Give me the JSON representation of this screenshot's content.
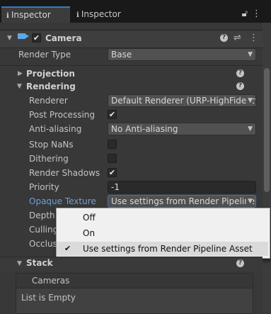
{
  "tabs": [
    {
      "label": "Inspector",
      "icon": "info-icon",
      "active": true
    },
    {
      "label": "Inspector",
      "icon": "info-icon",
      "active": false
    }
  ],
  "tab_icons": {
    "lock": "lock-icon",
    "menu": "kebab-menu-icon"
  },
  "component": {
    "title": "Camera",
    "enabled": true,
    "render_type_label": "Render Type",
    "render_type_value": "Base"
  },
  "sections": {
    "projection": "Projection",
    "rendering": "Rendering",
    "stack": "Stack"
  },
  "rendering": {
    "renderer_label": "Renderer",
    "renderer_value": "Default Renderer (URP-HighFidelity)",
    "post_processing_label": "Post Processing",
    "post_processing_checked": true,
    "anti_aliasing_label": "Anti-aliasing",
    "anti_aliasing_value": "No Anti-aliasing",
    "stop_nans_label": "Stop NaNs",
    "stop_nans_checked": false,
    "dithering_label": "Dithering",
    "dithering_checked": false,
    "render_shadows_label": "Render Shadows",
    "render_shadows_checked": true,
    "priority_label": "Priority",
    "priority_value": "-1",
    "opaque_texture_label": "Opaque Texture",
    "opaque_texture_value": "Use settings from Render Pipeline Asset",
    "depth_label": "Depth",
    "culling_label": "Culling",
    "occlusion_label": "Occlus"
  },
  "popup": {
    "items": [
      {
        "label": "Off",
        "checked": false
      },
      {
        "label": "On",
        "checked": false
      },
      {
        "label": "Use settings from Render Pipeline Asset",
        "checked": true
      }
    ]
  },
  "stack": {
    "list_header": "Cameras",
    "empty_text": "List is Empty"
  },
  "colors": {
    "background": "#383838",
    "tabbar": "#191919",
    "accent": "#3a79bb",
    "highlight_label": "#6f9ed6",
    "popup_background": "#f0f0f0"
  }
}
